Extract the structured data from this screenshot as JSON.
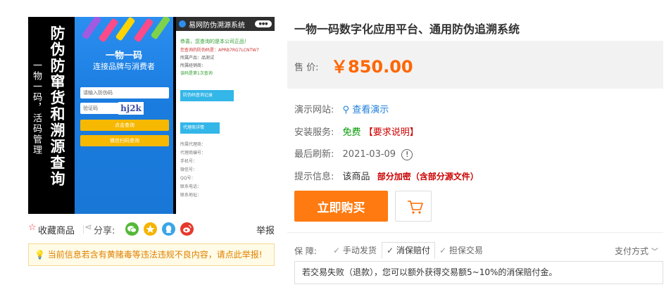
{
  "preview": {
    "big_title": "防伪防窜货和溯源查询",
    "side_slogan": "一物一码，活码管理",
    "panel_heading": "一物一码",
    "panel_sub": "连接品牌与消费者",
    "input1_placeholder": "请输入防伪码",
    "input2_placeholder": "验证码",
    "captcha": "hj2k",
    "btn1": "点击查询",
    "btn2": "微信扫码查询",
    "mock_title": "易网防伪溯源系统",
    "mock_badge": "●●●",
    "mock_ok_line": "恭喜，您查询的是本公司正品！",
    "mock_code_line": "您查询的防伪码是：APRB7RG7LCNTW7",
    "mock_product_line": "所属产品：品测试",
    "mock_time_line": "所属经销商：",
    "mock_count_line": "该码是第1次查询",
    "mock_section1": "防伪码查询记录",
    "mock_section2": "代理商详情",
    "mock_fields": [
      "所属代理商：",
      "代理商编号：",
      "手机号：",
      "微信号：",
      "QQ号：",
      "联系电话：",
      "联系地址："
    ]
  },
  "share": {
    "favorite_label": "收藏商品",
    "share_label": "分享:",
    "report_label": "举报"
  },
  "notice": "当前信息若含有黄赌毒等违法违规不良内容，请点此举报!",
  "product": {
    "title": "一物一码数字化应用平台、通用防伪追溯系统",
    "price_label": "售  价:",
    "price": "￥850.00"
  },
  "info": {
    "demo_label": "演示网站:",
    "demo_link": "查看演示",
    "install_label": "安装服务:",
    "install_value": "免费",
    "install_extra": "【要求说明】",
    "refresh_label": "最后刷新:",
    "refresh_value": "2021-03-09",
    "tip_label": "提示信息:",
    "tip_prefix": "该商品",
    "tip_highlight": "部分加密（含部分源文件）"
  },
  "buttons": {
    "buy": "立即购买"
  },
  "guarantee": {
    "label": "保  障:",
    "tabs": [
      "手动发货",
      "消保赔付",
      "担保交易"
    ],
    "pay_label": "支付方式",
    "desc": "若交易失败（退款），您可以额外获得交易额5~10%的消保赔付金。"
  },
  "colors": {
    "accent_orange": "#ff6600",
    "buy_button": "#ff7a10",
    "free_green": "#009900",
    "alert_red": "#cc0000",
    "link_blue": "#1e7fd8"
  }
}
